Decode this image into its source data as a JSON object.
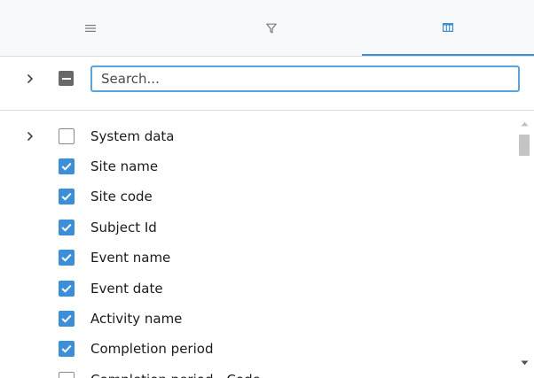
{
  "tabs": [
    {
      "icon": "menu-icon",
      "active": false
    },
    {
      "icon": "filter-icon",
      "active": false
    },
    {
      "icon": "columns-icon",
      "active": true
    }
  ],
  "search": {
    "placeholder": "Search...",
    "value": ""
  },
  "columns": [
    {
      "label": "System data",
      "checked": false,
      "expandable": true
    },
    {
      "label": "Site name",
      "checked": true,
      "expandable": false
    },
    {
      "label": "Site code",
      "checked": true,
      "expandable": false
    },
    {
      "label": "Subject Id",
      "checked": true,
      "expandable": false
    },
    {
      "label": "Event name",
      "checked": true,
      "expandable": false
    },
    {
      "label": "Event date",
      "checked": true,
      "expandable": false
    },
    {
      "label": "Activity name",
      "checked": true,
      "expandable": false
    },
    {
      "label": "Completion period",
      "checked": true,
      "expandable": false
    },
    {
      "label": "Completion period - Code",
      "checked": false,
      "expandable": false
    }
  ],
  "colors": {
    "accent": "#3b8fd9",
    "focus": "#57a3e3",
    "indeterminate": "#686868"
  }
}
